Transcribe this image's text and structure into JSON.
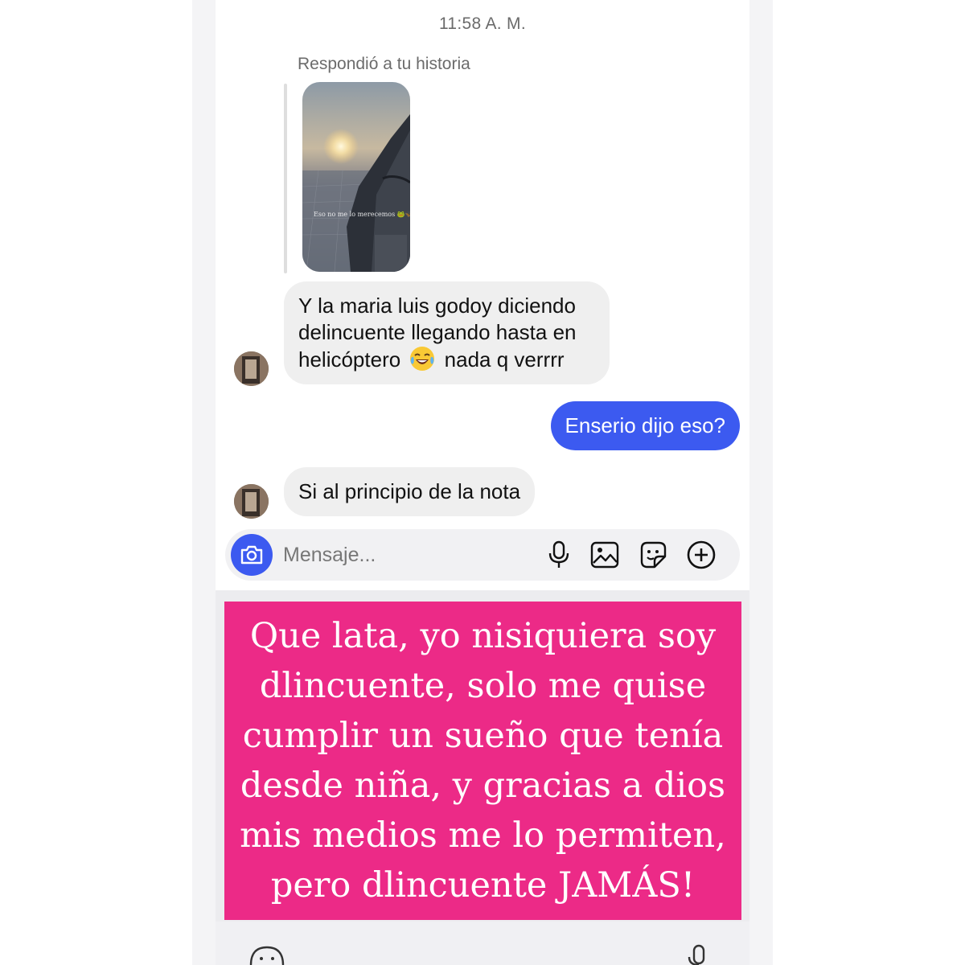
{
  "chat": {
    "timestamp": "11:58 A. M.",
    "reply_label": "Respondió a tu historia",
    "story": {
      "caption": "Eso no me lo merecemos 🐸🦋💕"
    },
    "messages": [
      {
        "sender": "them",
        "lines": [
          "Y la maria luis godoy diciendo",
          "delincuente llegando hasta en"
        ],
        "line3_before_emoji": "helicóptero",
        "emoji": "face-with-tears-of-joy-icon",
        "line3_after_emoji": "nada q verrrr"
      },
      {
        "sender": "me",
        "text": "Enserio dijo eso?"
      },
      {
        "sender": "them",
        "text": "Si al principio de la nota"
      }
    ],
    "composer": {
      "placeholder": "Mensaje...",
      "icons": [
        "camera-icon",
        "microphone-icon",
        "image-icon",
        "sticker-icon",
        "add-icon"
      ]
    },
    "colors": {
      "outgoing_bubble": "#3c5af0",
      "incoming_bubble": "#efefef",
      "overlay": "#ec2a87"
    }
  },
  "overlay_text": {
    "lines": [
      "Que lata, yo nisiquiera soy",
      "dlincuente, solo me quise",
      "cumplir un sueño que tenía",
      "desde niña, y gracias a dios",
      "mis medios me lo permiten,",
      "pero dlincuente JAMÁS!"
    ]
  }
}
